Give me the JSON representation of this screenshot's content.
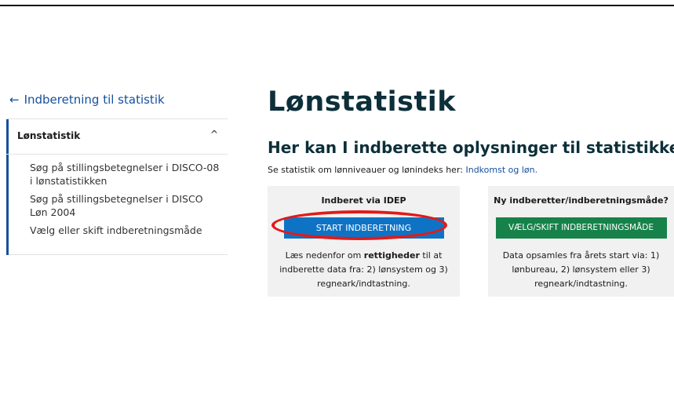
{
  "sidebar": {
    "back_link": "Indberetning til statistik",
    "section_title": "Lønstatistik",
    "items": [
      "Søg på stillingsbetegnelser i DISCO-08 i lønstatistikken",
      "Søg på stillingsbetegnelser i DISCO Løn 2004",
      "Vælg eller skift indberetningsmåde"
    ]
  },
  "main": {
    "title": "Lønstatistik",
    "subtitle": "Her kan I indberette oplysninger til statistikken",
    "intro_text": "Se statistik om lønniveauer og lønindeks her: ",
    "intro_link": "Indkomst og løn."
  },
  "cards": [
    {
      "title": "Indberet via IDEP",
      "button": "START INDBERETNING",
      "text_before": "Læs nedenfor om ",
      "text_bold": "rettigheder",
      "text_after": " til at indberette data fra: 2) lønsystem og 3) regneark/indtastning."
    },
    {
      "title": "Ny indberetter/indberetningsmåde?",
      "button": "VÆLG/SKIFT INDBERETNINGSMÅDE",
      "text": "Data opsamles fra årets start via: 1) lønbureau, 2) lønsystem eller 3) regneark/indtastning."
    }
  ],
  "colors": {
    "link": "#14509e",
    "button_blue": "#0f73c5",
    "button_green": "#16824a",
    "annotation_red": "#e01b1b"
  }
}
